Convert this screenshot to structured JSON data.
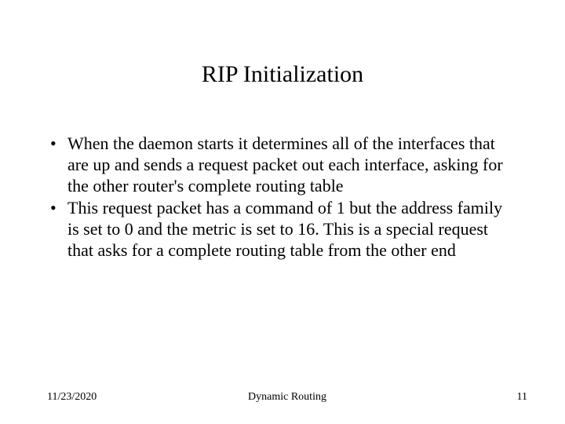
{
  "title": "RIP Initialization",
  "bullets": [
    "When the daemon starts it determines all of the interfaces that are up and sends a request packet out each interface, asking for the other router's complete routing table",
    "This request packet has a command of 1 but the address family is set to 0 and the metric is set to 16. This is a special request that asks for a complete routing table from the other end"
  ],
  "footer": {
    "date": "11/23/2020",
    "center": "Dynamic Routing",
    "page": "11"
  }
}
